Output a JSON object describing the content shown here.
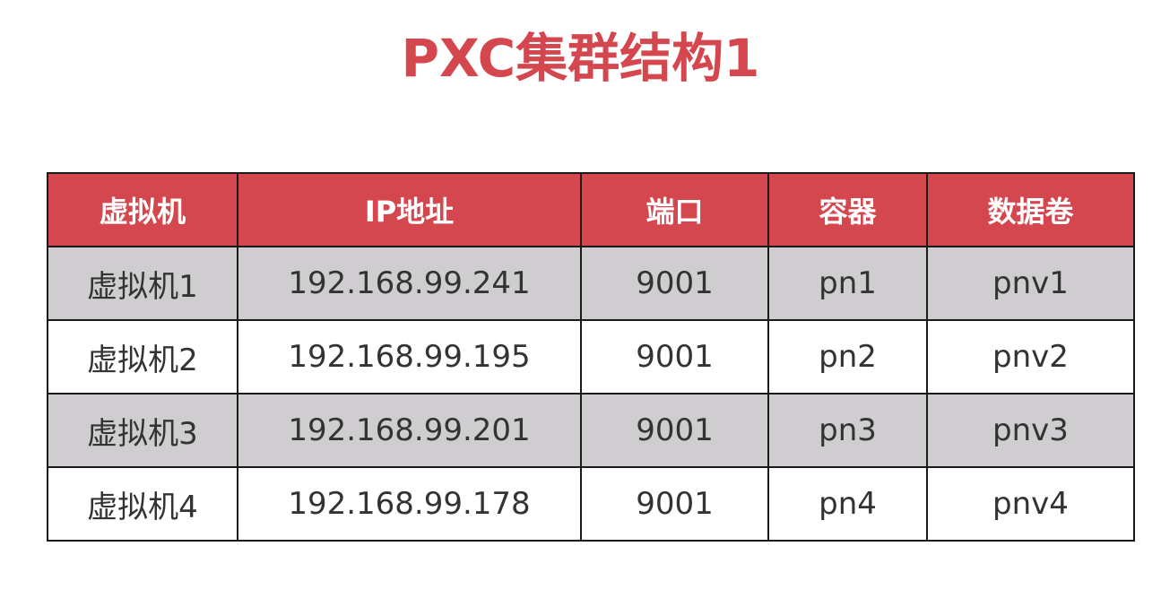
{
  "title": "PXC集群结构1",
  "table": {
    "headers": [
      "虚拟机",
      "IP地址",
      "端口",
      "容器",
      "数据卷"
    ],
    "rows": [
      [
        "虚拟机1",
        "192.168.99.241",
        "9001",
        "pn1",
        "pnv1"
      ],
      [
        "虚拟机2",
        "192.168.99.195",
        "9001",
        "pn2",
        "pnv2"
      ],
      [
        "虚拟机3",
        "192.168.99.201",
        "9001",
        "pn3",
        "pnv3"
      ],
      [
        "虚拟机4",
        "192.168.99.178",
        "9001",
        "pn4",
        "pnv4"
      ]
    ]
  },
  "colors": {
    "accent": "#d5474f",
    "row_shaded": "#cfcdd0",
    "row_plain": "#ffffff",
    "border": "#1a1a1a"
  }
}
